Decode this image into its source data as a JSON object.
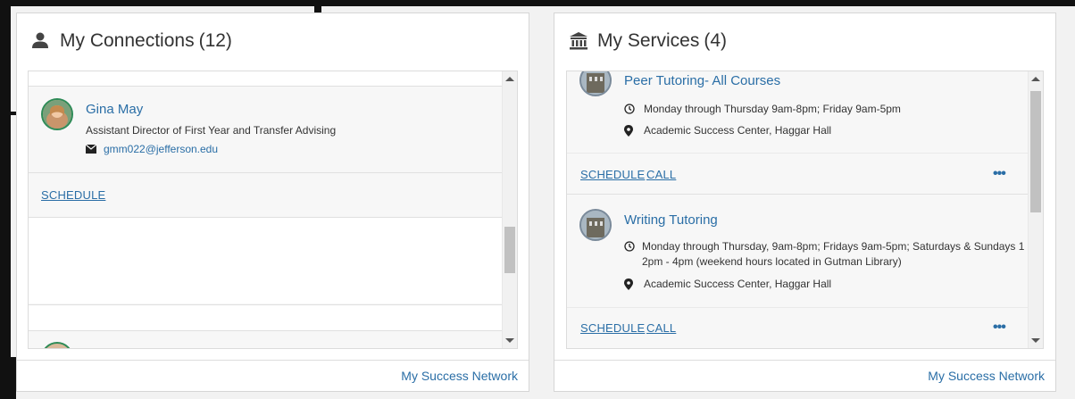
{
  "background": {
    "fragment_letter": "S"
  },
  "connections": {
    "title": "My Connections",
    "count": "(12)",
    "contact": {
      "name": "Gina May",
      "role": "Assistant Director of First Year and Transfer Advising",
      "email": "gmm022@jefferson.edu",
      "schedule_label": "SCHEDULE"
    },
    "footer_link": "My Success Network"
  },
  "services": {
    "title": "My Services",
    "count": "(4)",
    "items": [
      {
        "name": "Peer Tutoring- All Courses",
        "hours": "Monday through Thursday 9am-8pm; Friday 9am-5pm",
        "location": "Academic Success Center, Haggar Hall",
        "schedule_label": "SCHEDULE",
        "call_label": "CALL",
        "more_label": "•••"
      },
      {
        "name": "Writing Tutoring",
        "hours": "Monday through Thursday, 9am-8pm; Fridays 9am-5pm; Saturdays & Sundays 1 2pm - 4pm (weekend hours located in Gutman Library)",
        "location": "Academic Success Center, Haggar Hall",
        "schedule_label": "SCHEDULE",
        "call_label": "CALL",
        "more_label": "•••"
      }
    ],
    "footer_link": "My Success Network"
  },
  "colors": {
    "link": "#2a6ea6",
    "avatar_ring": "#2e8b57"
  }
}
